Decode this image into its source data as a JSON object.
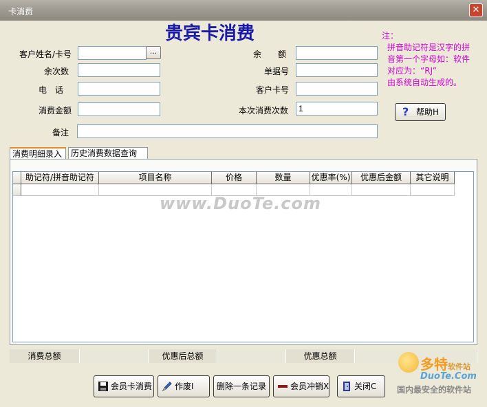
{
  "window": {
    "title": "卡消费",
    "close_label": "✕"
  },
  "heading": "贵宾卡消费",
  "note": {
    "line1": "注：",
    "lines": [
      "拼音助记符是汉字的拼",
      "音第一个字母如：软件",
      "对应为：“RJ”",
      "由系统自动生成的。"
    ],
    "color": "#d000d0"
  },
  "form": {
    "customer_label": "客户姓名/卡号",
    "customer_value": "",
    "browse_label": "...",
    "balance_label": "余　　额",
    "balance_value": "",
    "remaining_label": "余次数",
    "remaining_value": "",
    "receipt_label": "单据号",
    "receipt_value": "",
    "phone_label": "电　话",
    "phone_value": "",
    "card_label": "客户卡号",
    "card_value": "",
    "amount_label": "消费金额",
    "amount_value": "",
    "times_label": "本次消费次数",
    "times_value": "1",
    "remark_label": "备注",
    "remark_value": ""
  },
  "help_button": {
    "icon": "question-icon",
    "label": "帮助H"
  },
  "tabs": [
    {
      "label": "消费明细录入",
      "active": true
    },
    {
      "label": "历史消费数据查询",
      "active": false
    }
  ],
  "grid": {
    "columns": [
      "助记符/拼音助记符",
      "项目名称",
      "价格",
      "数量",
      "优惠率(%)",
      "优惠后金额",
      "其它说明"
    ]
  },
  "watermark": "www.DuoTe.com",
  "totals": {
    "total_label": "消费总额",
    "total_value": "",
    "discounted_label": "优惠后总额",
    "discounted_value": "",
    "discount_label": "优惠总额",
    "discount_value": ""
  },
  "buttons": {
    "consume": {
      "label": "会员卡消费",
      "icon": "floppy-disk-icon"
    },
    "void": {
      "label": "作废I",
      "icon": "pen-icon"
    },
    "delete_row": {
      "label": "删除一条记录"
    },
    "reverse": {
      "label": "会员冲销X",
      "icon": "minus-bar-icon"
    },
    "close": {
      "label": "关闭C",
      "icon": "exit-door-icon"
    }
  },
  "branding": {
    "name": "多特",
    "name_suffix": "软件站",
    "site": "DuoTe.Com",
    "slogan": "国内最安全的软件站"
  }
}
